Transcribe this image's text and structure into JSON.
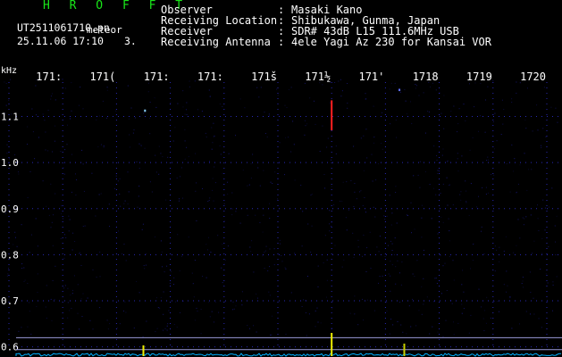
{
  "header": {
    "brand": "H R O F F T",
    "filename": "UT2511061710.pn",
    "tag": "meteor",
    "timestamp": "25.11.06 17:10",
    "count": "3."
  },
  "info": [
    {
      "label": "Observer",
      "value": "Masaki Kano"
    },
    {
      "label": "Receiving Location",
      "value": "Shibukawa, Gunma, Japan"
    },
    {
      "label": "Receiver",
      "value": "SDR# 43dB L15 111.6MHz USB"
    },
    {
      "label": "Receiving Antenna",
      "value": "4ele Yagi Az 230 for Kansai VOR"
    }
  ],
  "colon": ":",
  "plot": {
    "unit_label": "kHz",
    "x_ticks": [
      "171̱",
      "171̸",
      "171̃",
      "171̵",
      "1715",
      "1716",
      "171̱",
      "1718",
      "1719",
      "1720"
    ],
    "x_tick_labels": [
      "171:",
      "171(",
      "171:",
      "171:",
      "171š",
      "171½",
      "171'",
      "1718",
      "1719",
      "1720"
    ],
    "x_range": [
      1710,
      1720
    ],
    "y_range": [
      0.58,
      1.19
    ],
    "y_ticks": [
      {
        "value": 1.1,
        "label": "1.1"
      },
      {
        "value": 1.0,
        "label": "1.0"
      },
      {
        "value": 0.9,
        "label": "0.9"
      },
      {
        "value": 0.8,
        "label": "0.8"
      },
      {
        "value": 0.7,
        "label": "0.7"
      },
      {
        "value": 0.6,
        "label": "0.6"
      }
    ],
    "reference_lines_khz": [
      0.62,
      0.594
    ],
    "echoes": [
      {
        "minute": 1716,
        "y_from": 1.07,
        "y_to": 1.135,
        "color": "#ff2020"
      },
      {
        "minute": 1712.53,
        "y_from": 1.11,
        "y_to": 1.115,
        "color": "#8ad0ff"
      },
      {
        "minute": 1717.26,
        "y_from": 1.155,
        "y_to": 1.16,
        "color": "#5f6fff"
      }
    ],
    "bottom_spikes": [
      {
        "minute": 1712.5,
        "height": 12,
        "color": "#f0f000"
      },
      {
        "minute": 1716.0,
        "height": 26,
        "color": "#f0f000"
      },
      {
        "minute": 1717.35,
        "height": 14,
        "color": "#c8d000"
      }
    ],
    "colors": {
      "background": "#000000",
      "grid": "#3a3aff",
      "noise": "#1a1a80",
      "ref_line": "#9a9ad8",
      "spectrum": "#00b0ff"
    }
  }
}
